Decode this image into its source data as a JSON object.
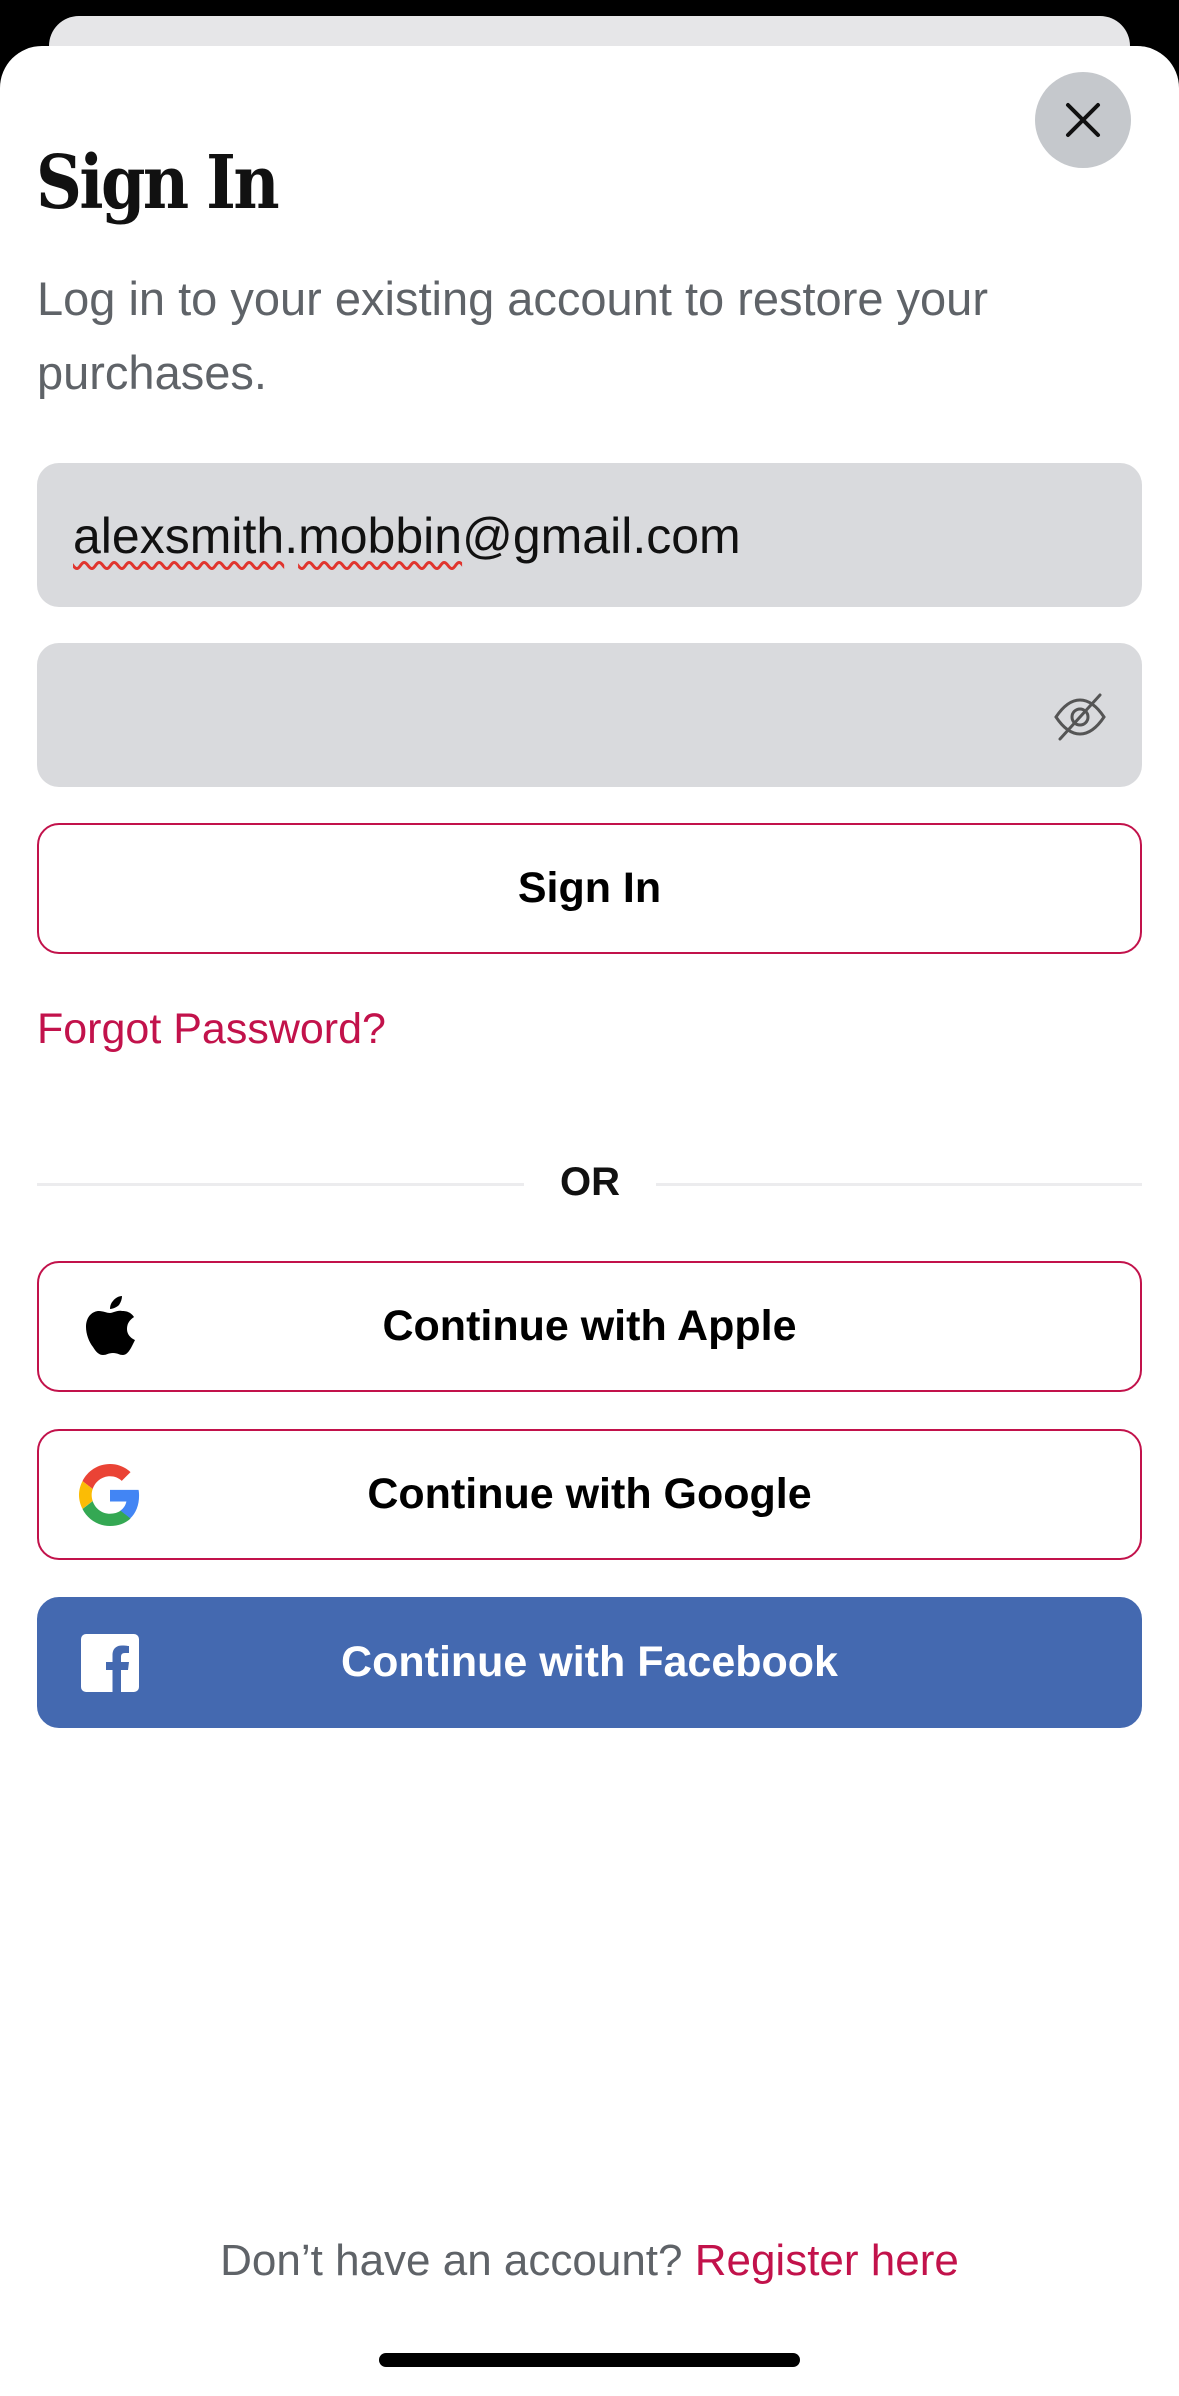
{
  "header": {
    "title": "Sign In",
    "subtitle": "Log in to your existing account to restore your purchases."
  },
  "form": {
    "email_value_part1": "alexsmith",
    "email_value_part2": ".",
    "email_value_part3": "mobbin",
    "email_value_part4": "@gmail.com",
    "password_value": "",
    "sign_in_label": "Sign In",
    "forgot_password_label": "Forgot Password?"
  },
  "divider": {
    "label": "OR"
  },
  "social": {
    "apple_label": "Continue with Apple",
    "google_label": "Continue with Google",
    "facebook_label": "Continue with Facebook"
  },
  "footer": {
    "prompt": "Don’t have an account? ",
    "register_label": "Register here"
  },
  "icons": {
    "close": "close-icon",
    "password_visibility": "eye-off-icon",
    "apple": "apple-logo-icon",
    "google": "google-logo-icon",
    "facebook": "facebook-logo-icon"
  },
  "colors": {
    "accent": "#c2124b",
    "facebook": "#4469b0",
    "field_bg": "#d9dadd",
    "subtitle_text": "#5f6368"
  }
}
